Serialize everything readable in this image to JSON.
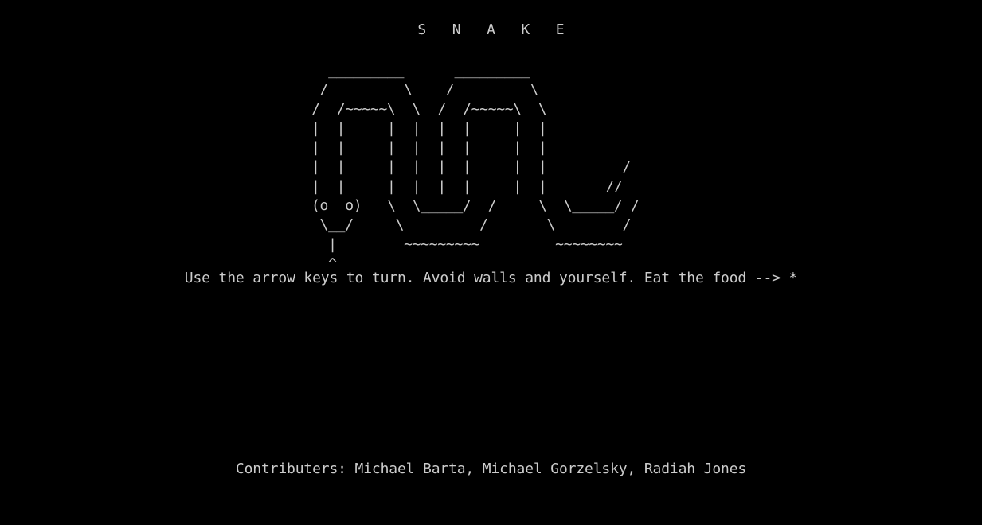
{
  "game": {
    "title": "S   N   A   K   E",
    "ascii_art": "  _________      _________\n /         \\    /         \\\n/  /~~~~~\\  \\  /  /~~~~~\\  \\\n|  |     |  |  |  |     |  |\n|  |     |  |  |  |     |  |\n|  |     |  |  |  |     |  |         /\n|  |     |  |  |  |     |  |       //\n(o  o)   \\  \\_____/  /     \\  \\_____/ /\n \\__/     \\         /       \\        /\n  |        ~~~~~~~~~         ~~~~~~~~\n  ^",
    "instructions": "Use the arrow keys to turn. Avoid walls and yourself. Eat the food --> *",
    "credits": "Contributers: Michael Barta, Michael Gorzelsky, Radiah Jones"
  },
  "colors": {
    "background": "#000000",
    "text": "#cccccc"
  }
}
